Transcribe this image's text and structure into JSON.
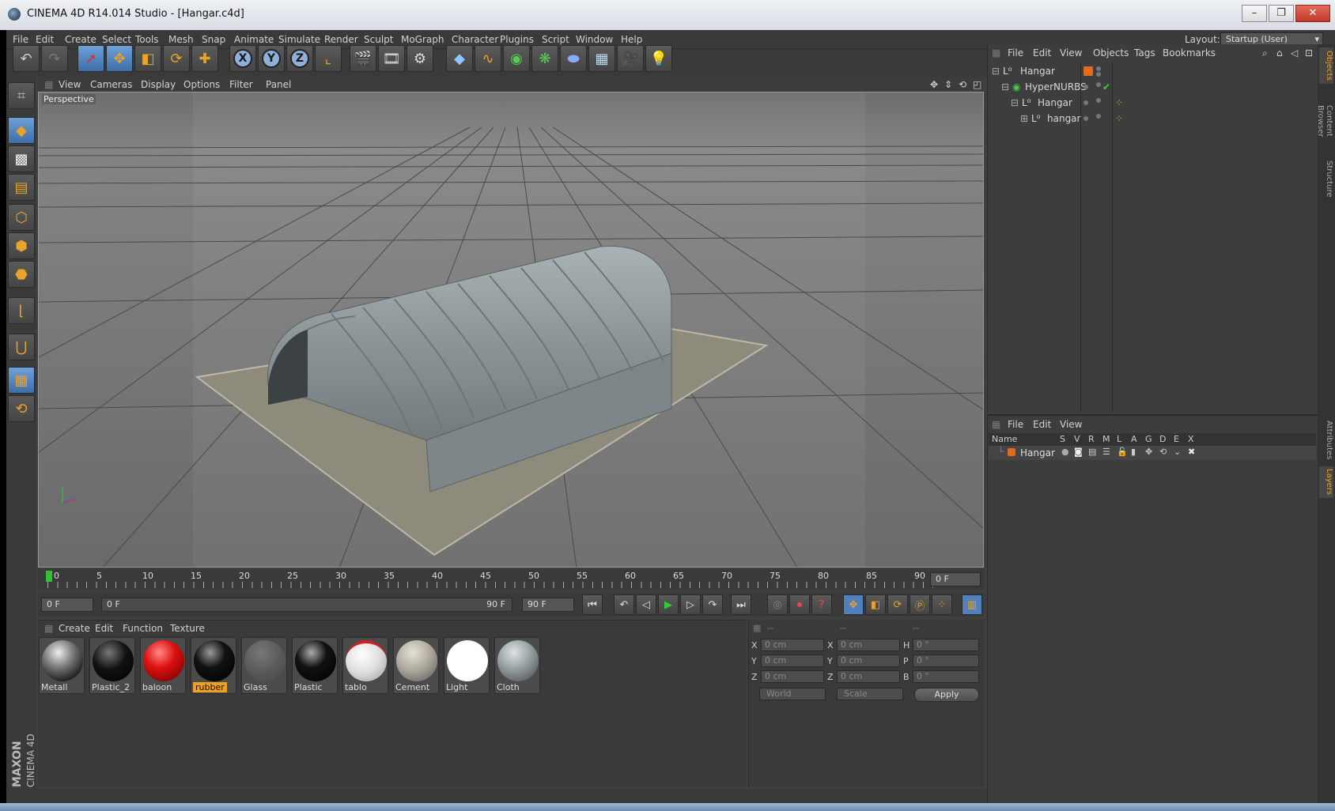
{
  "window": {
    "title": "CINEMA 4D R14.014 Studio - [Hangar.c4d]",
    "minimize": "–",
    "restore": "❐",
    "close": "✕"
  },
  "menu": [
    "File",
    "Edit",
    "Create",
    "Select",
    "Tools",
    "Mesh",
    "Snap",
    "Animate",
    "Simulate",
    "Render",
    "Sculpt",
    "MoGraph",
    "Character",
    "Plugins",
    "Script",
    "Window",
    "Help"
  ],
  "layout": {
    "label": "Layout:",
    "value": "Startup (User)"
  },
  "viewport": {
    "menu": [
      "View",
      "Cameras",
      "Display",
      "Options",
      "Filter",
      "Panel"
    ],
    "label": "Perspective"
  },
  "timeline": {
    "ticks": [
      "0",
      "5",
      "10",
      "15",
      "20",
      "25",
      "30",
      "35",
      "40",
      "45",
      "50",
      "55",
      "60",
      "65",
      "70",
      "75",
      "80",
      "85",
      "90"
    ],
    "current_frame": "0 F",
    "start_field": "0 F",
    "range_left": "0 F",
    "range_right": "90 F",
    "end_field": "90 F"
  },
  "materials": {
    "menu": [
      "Create",
      "Edit",
      "Function",
      "Texture"
    ],
    "items": [
      {
        "name": "Metall"
      },
      {
        "name": "Plastic_2"
      },
      {
        "name": "baloon"
      },
      {
        "name": "rubber"
      },
      {
        "name": "Glass"
      },
      {
        "name": "Plastic"
      },
      {
        "name": "tablo"
      },
      {
        "name": "Cement"
      },
      {
        "name": "Light"
      },
      {
        "name": "Cloth"
      }
    ],
    "selected": "rubber"
  },
  "coords": {
    "headers": [
      "--",
      "--",
      "--"
    ],
    "rows": [
      {
        "a": "X",
        "av": "0 cm",
        "b": "X",
        "bv": "0 cm",
        "c": "H",
        "cv": "0 °"
      },
      {
        "a": "Y",
        "av": "0 cm",
        "b": "Y",
        "bv": "0 cm",
        "c": "P",
        "cv": "0 °"
      },
      {
        "a": "Z",
        "av": "0 cm",
        "b": "Z",
        "bv": "0 cm",
        "c": "B",
        "cv": "0 °"
      }
    ],
    "mode": "World",
    "size": "Scale",
    "apply": "Apply"
  },
  "objects": {
    "menu": [
      "File",
      "Edit",
      "View",
      "Objects",
      "Tags",
      "Bookmarks"
    ],
    "tree": [
      {
        "name": "Hangar"
      },
      {
        "name": "HyperNURBS"
      },
      {
        "name": "Hangar"
      },
      {
        "name": "hangar"
      }
    ]
  },
  "layers": {
    "menu": [
      "File",
      "Edit",
      "View"
    ],
    "columns": [
      "Name",
      "S",
      "V",
      "R",
      "M",
      "L",
      "A",
      "G",
      "D",
      "E",
      "X"
    ],
    "rows": [
      {
        "name": "Hangar"
      }
    ]
  },
  "side_tabs": [
    "Objects",
    "Content Browser",
    "Structure",
    "Attributes",
    "Layers"
  ],
  "brand": {
    "line1": "MAXON",
    "line2": "CINEMA 4D"
  },
  "colors": {
    "accent": "#e9a22a",
    "selection_blue": "#4f80bd",
    "background": "#3f3f3f"
  }
}
